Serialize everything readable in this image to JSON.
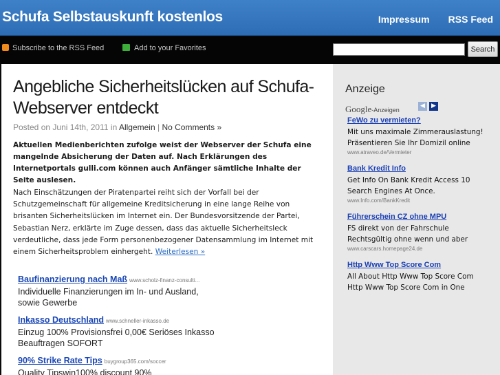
{
  "header": {
    "site_title": "Schufa Selbstauskunft kostenlos",
    "nav": [
      "Impressum",
      "RSS Feed"
    ]
  },
  "subbar": {
    "rss_link": "Subscribe to the RSS Feed",
    "fav_link": "Add to your Favorites",
    "search_placeholder": "",
    "search_button": "Search"
  },
  "post": {
    "title": "Angebliche Sicherheitslücken auf Schufa-Webserver entdeckt",
    "posted_prefix": "Posted on",
    "date": "Juni 14th, 2011",
    "in_word": "in",
    "category": "Allgemein",
    "separator": "|",
    "comments": "No Comments »",
    "lead": "Aktuellen Medienberichten zufolge weist der Webserver der Schufa eine mangelnde Absicherung der Daten auf. Nach Erklärungen des Internetportals gulli.com können auch Anfänger sämtliche Inhalte der Seite auslesen.",
    "body": "Nach Einschätzungen der Piratenpartei reiht sich der Vorfall bei der Schutzgemeinschaft für allgemeine Kreditsicherung in eine lange Reihe von brisanten Sicherheitslücken im Internet ein. Der Bundesvorsitzende der Partei, Sebastian Nerz, erklärte im Zuge dessen, dass das aktuelle Sicherheitsleck verdeutliche, dass jede Form personenbezogener Datensammlung im Internet mit einem Sicherheitsproblem einhergeht.",
    "read_more": "Weiterlesen »"
  },
  "content_ads": [
    {
      "title": "Baufinanzierung nach Maß",
      "url": "www.scholz-finanz-consulti...",
      "desc": "Individuelle Finanzierungen im In- und Ausland, sowie Gewerbe"
    },
    {
      "title": "Inkasso Deutschland",
      "url": "www.schneller-inkasso.de",
      "desc": "Einzug 100% Provisionsfrei 0,00€ Seriöses Inkasso Beauftragen SOFORT"
    },
    {
      "title": "90% Strike Rate Tips",
      "url": "buygroup365.com/soccer",
      "desc": "Quality Tipswin100% discount 90%"
    }
  ],
  "sidebar": {
    "title": "Anzeige",
    "google_label": "Google",
    "anzeigen_label": "-Anzeigen",
    "prev_icon": "◀",
    "next_icon": "▶",
    "ads": [
      {
        "title": "FeWo zu vermieten?",
        "desc": "Mit uns maximale Zimmerauslastung! Präsentieren Sie Ihr Domizil online",
        "url": "www.atraveo.de/Vermieter"
      },
      {
        "title": "Bank Kredit Info",
        "desc": "Get Info On Bank Kredit Access 10 Search Engines At Once.",
        "url": "www.Info.com/BankKredit"
      },
      {
        "title": "Führerschein CZ ohne MPU",
        "desc": "FS direkt von der Fahrschule Rechtsgültig ohne wenn und aber",
        "url": "www.carscars.homepage24.de"
      },
      {
        "title": "Http Www Top Score Com",
        "desc": "All About Http Www Top Score Com Http Www Top Score Com in One",
        "url": ""
      }
    ]
  }
}
